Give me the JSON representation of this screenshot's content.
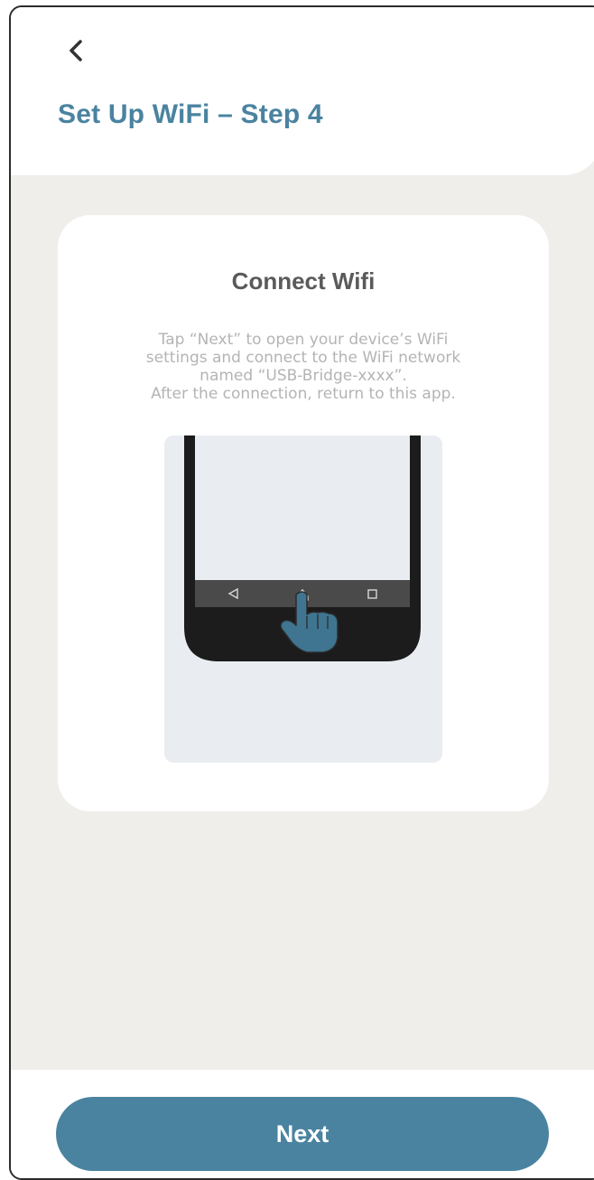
{
  "header": {
    "back_icon": "chevron-left-icon",
    "title": "Set Up WiFi – Step 4"
  },
  "card": {
    "title": "Connect Wifi",
    "description_lines": [
      "Tap “Next” to open your device’s WiFi",
      "settings and connect to the WiFi network",
      "named “USB-Bridge-xxxx”.",
      "After the connection, return to this app."
    ],
    "illustration": {
      "nav_icons": [
        "back-triangle-icon",
        "home-icon",
        "recents-square-icon"
      ],
      "pointer_icon": "tapping-hand-icon"
    }
  },
  "footer": {
    "next_label": "Next"
  },
  "colors": {
    "accent": "#4a83a0",
    "background": "#efeeea",
    "card": "#ffffff",
    "illustration_bg": "#e9ecf1",
    "phone_body": "#1c1c1c"
  }
}
